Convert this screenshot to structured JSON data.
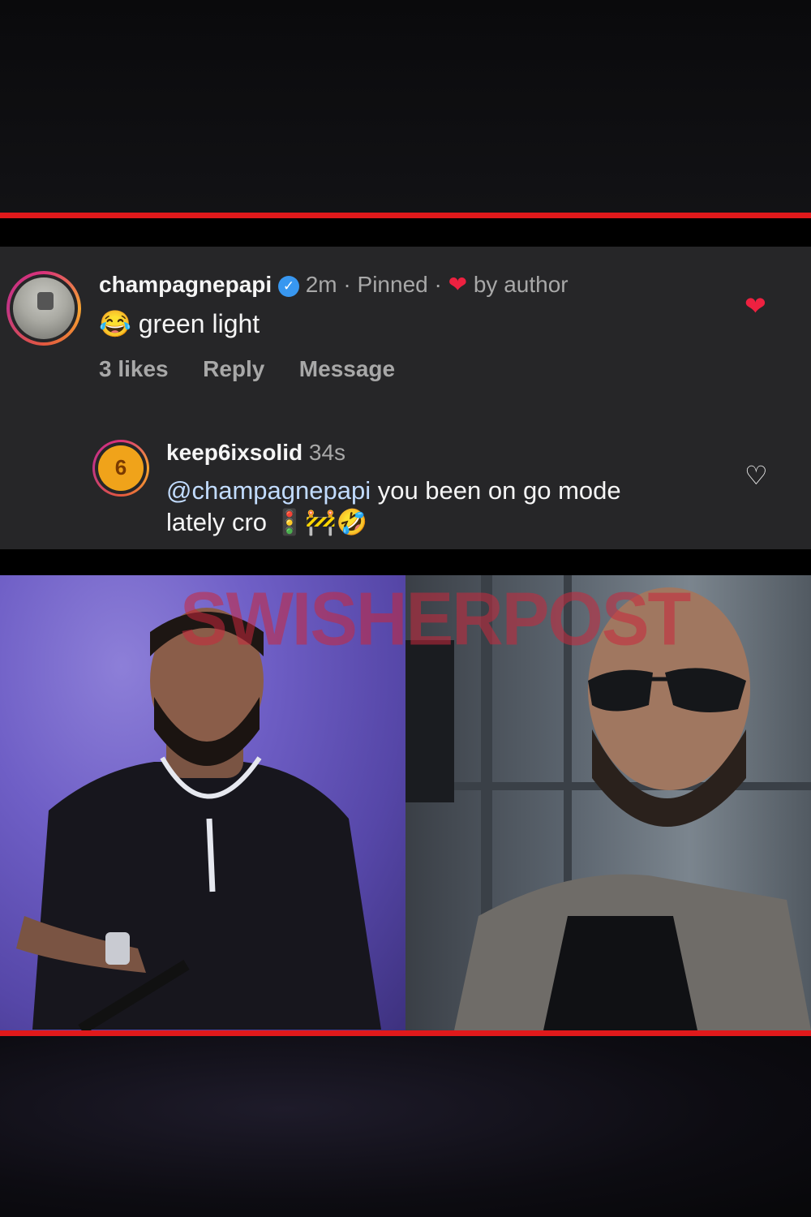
{
  "comments": [
    {
      "username": "champagnepapi",
      "time": "2m",
      "pinned_label": "Pinned",
      "by_author_label": "by author",
      "emoji": "😂",
      "text": "green light",
      "likes_label": "3 likes",
      "reply_label": "Reply",
      "message_label": "Message",
      "liked": true
    },
    {
      "username": "keep6ixsolid",
      "time": "34s",
      "mention": "@champagnepapi",
      "text_line1": " you been on go mode",
      "text_line2": "lately cro",
      "emojis": "🚦🚧🤣",
      "avatar_letter": "6",
      "liked": false
    }
  ],
  "watermark": "SWISHERPOST",
  "colors": {
    "accent_red": "#e0191b",
    "heart": "#ed2140",
    "verified": "#3897f0",
    "panel": "#262628"
  }
}
